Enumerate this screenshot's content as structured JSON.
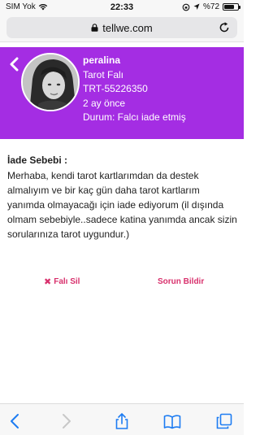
{
  "status_bar": {
    "carrier": "SIM Yok",
    "time": "22:33",
    "battery_percent": "%72",
    "battery_level": 0.72
  },
  "browser": {
    "url": "tellwe.com"
  },
  "profile": {
    "name": "peralina",
    "service": "Tarot Falı",
    "code": "TRT-55226350",
    "time_ago": "2 ay önce",
    "status": "Durum: Falcı iade etmiş"
  },
  "refund": {
    "title": "İade Sebebi :",
    "text": "Merhaba, kendi tarot kartlarımdan da destek almalıyım ve bir kaç gün daha tarot kartlarım yanımda olmayacağı için iade ediyorum (il dışında olmam sebebiyle..sadece katina yanımda ancak sizin sorularınıza tarot uygundur.)"
  },
  "actions": {
    "delete_label": "Falı Sil",
    "report_label": "Sorun Bildir"
  },
  "colors": {
    "header_bg": "#a42de3",
    "action_color": "#d8306c",
    "ios_blue": "#1d7cf2"
  },
  "icons": [
    "wifi-icon",
    "lock-icon",
    "reload-icon",
    "back-icon",
    "close-icon",
    "share-icon",
    "bookmarks-icon",
    "tabs-icon"
  ]
}
